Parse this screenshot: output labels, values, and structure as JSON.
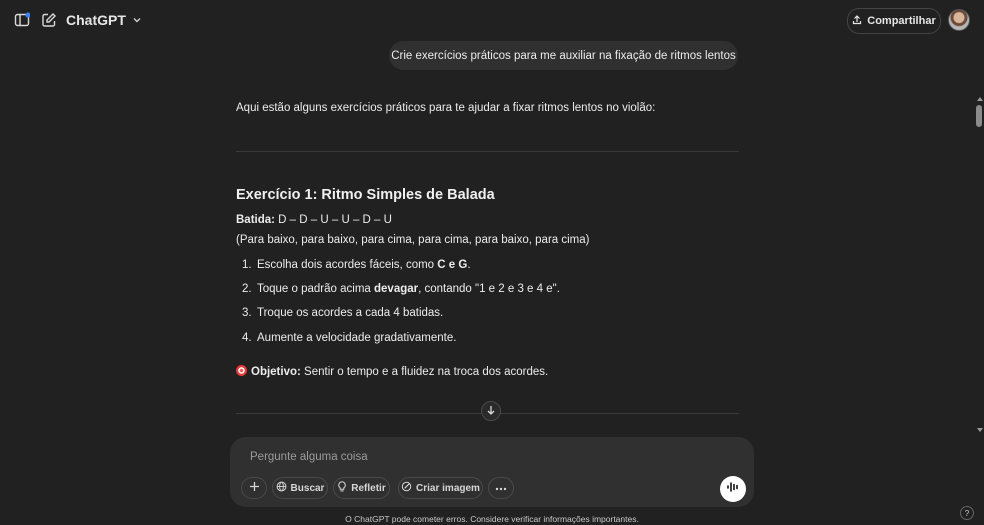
{
  "header": {
    "model_name": "ChatGPT",
    "share_label": "Compartilhar",
    "icons": [
      "sidebar-toggle-icon",
      "new-chat-icon",
      "chevron-down-icon",
      "share-upload-icon"
    ]
  },
  "conversation": {
    "user_message": "Crie exercícios práticos para me auxiliar na fixação de ritmos lentos",
    "intro": "Aqui estão alguns exercícios práticos para te ajudar a fixar ritmos lentos no violão:",
    "exercise_title": "Exercício 1: Ritmo Simples de Balada",
    "strum_label": "Batida:",
    "strum_pattern": " D – D – U – U – D – U",
    "strum_explanation": "(Para baixo, para baixo, para cima, para cima, para baixo, para cima)",
    "steps": [
      {
        "num": "1.",
        "pre": "Escolha dois acordes fáceis, como ",
        "bold": "C e G",
        "post": "."
      },
      {
        "num": "2.",
        "pre": "Toque o padrão acima ",
        "bold": "devagar",
        "post": ", contando \"1 e 2 e 3 e 4 e\"."
      },
      {
        "num": "3.",
        "pre": "Troque os acordes a cada 4 batidas.",
        "bold": "",
        "post": ""
      },
      {
        "num": "4.",
        "pre": "Aumente a velocidade gradativamente.",
        "bold": "",
        "post": ""
      }
    ],
    "objective_label": "Objetivo:",
    "objective_text": " Sentir o tempo e a fluidez na troca dos acordes."
  },
  "composer": {
    "placeholder": "Pergunte alguma coisa",
    "tools": {
      "search": "Buscar",
      "reason": "Refletir",
      "image": "Criar imagem"
    }
  },
  "footer": {
    "disclaimer": "O ChatGPT pode cometer erros. Considere verificar informações importantes.",
    "help": "?"
  },
  "colors": {
    "background": "#212121",
    "bubble": "#303030",
    "text": "#ececec"
  }
}
